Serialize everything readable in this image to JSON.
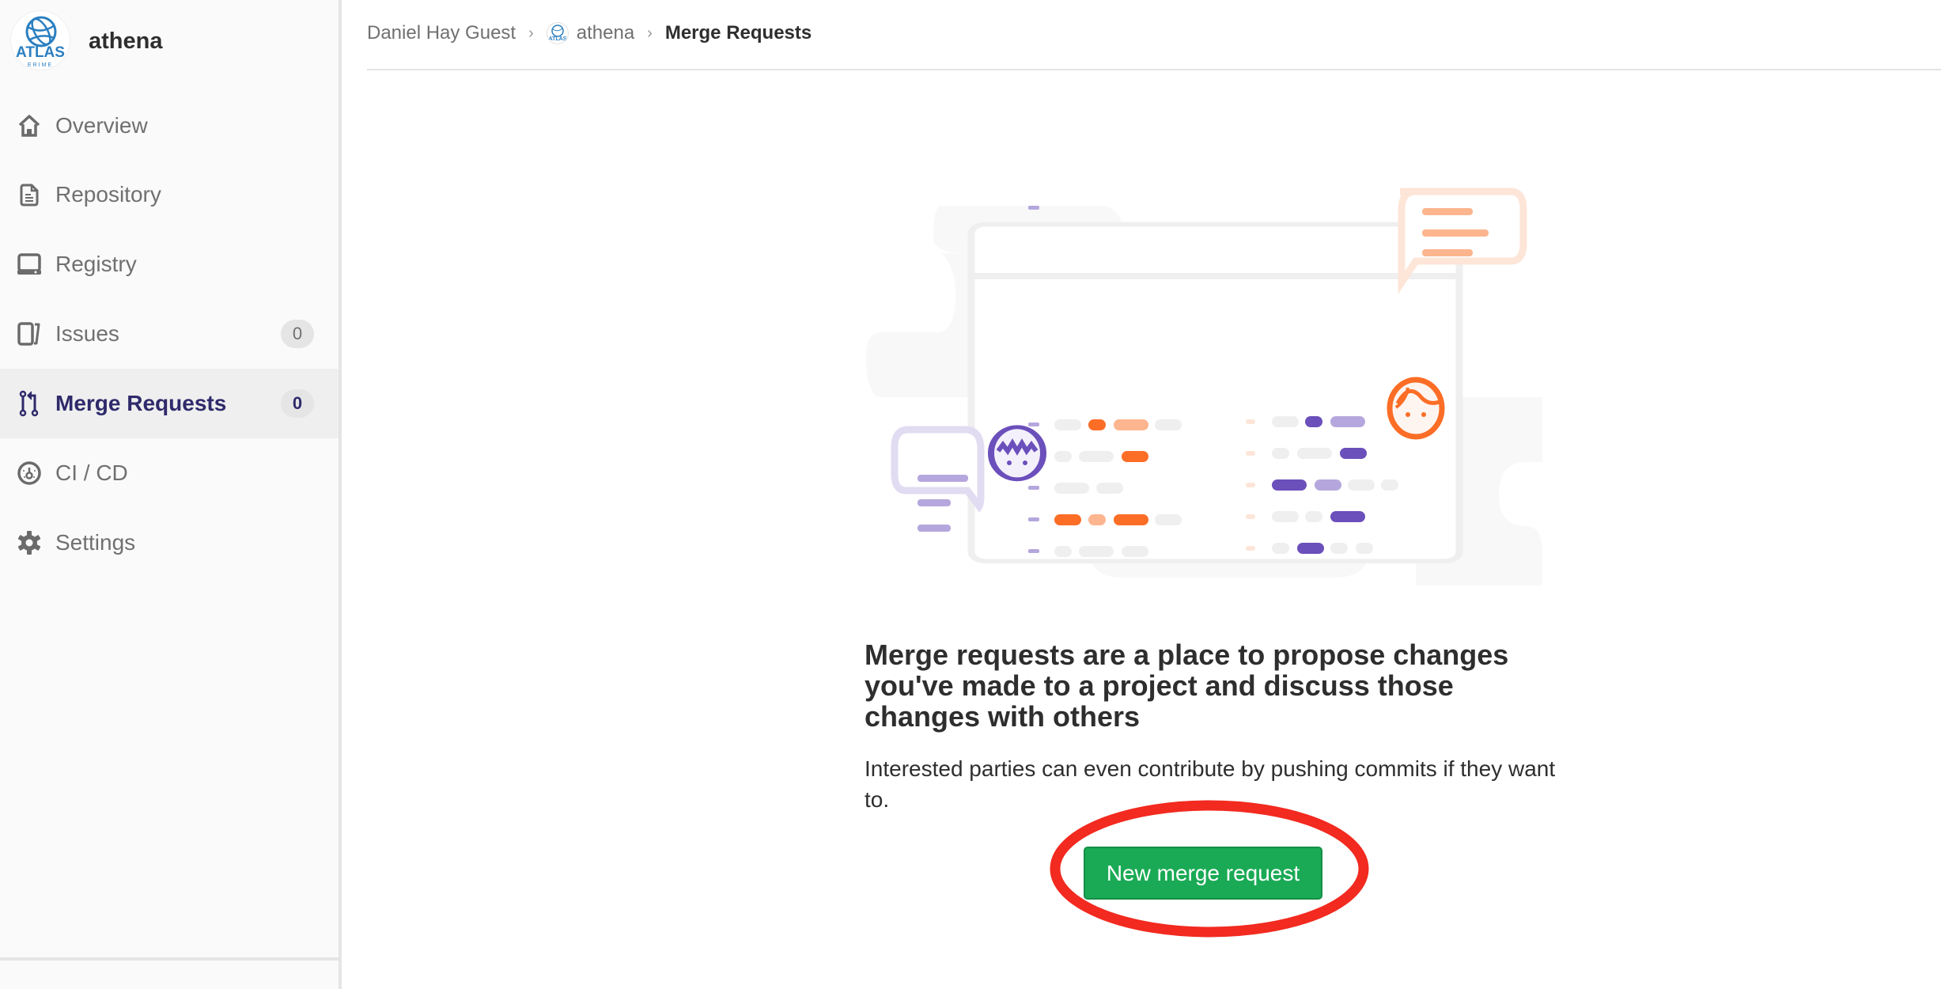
{
  "sidebar": {
    "project_name": "athena",
    "logo_text": "ATLAS",
    "items": [
      {
        "label": "Overview",
        "icon": "home-icon",
        "badge": null,
        "active": false
      },
      {
        "label": "Repository",
        "icon": "doc-icon",
        "badge": null,
        "active": false
      },
      {
        "label": "Registry",
        "icon": "registry-icon",
        "badge": null,
        "active": false
      },
      {
        "label": "Issues",
        "icon": "issues-icon",
        "badge": "0",
        "active": false
      },
      {
        "label": "Merge Requests",
        "icon": "merge-request-icon",
        "badge": "0",
        "active": true
      },
      {
        "label": "CI / CD",
        "icon": "rocket-icon",
        "badge": null,
        "active": false
      },
      {
        "label": "Settings",
        "icon": "gear-icon",
        "badge": null,
        "active": false
      }
    ]
  },
  "breadcrumb": {
    "items": [
      "Daniel Hay Guest",
      "athena",
      "Merge Requests"
    ],
    "separator": "›"
  },
  "empty_state": {
    "title": "Merge requests are a place to propose changes you've made to a project and discuss those changes with others",
    "text": "Interested parties can even contribute by pushing commits if they want to.",
    "button_label": "New merge request"
  },
  "colors": {
    "accent": "#2f2a6b",
    "button_green": "#1aaa55",
    "annotation_red": "#f22a1f",
    "illustration_orange": "#fc6d26",
    "illustration_purple": "#6b4fbb"
  }
}
